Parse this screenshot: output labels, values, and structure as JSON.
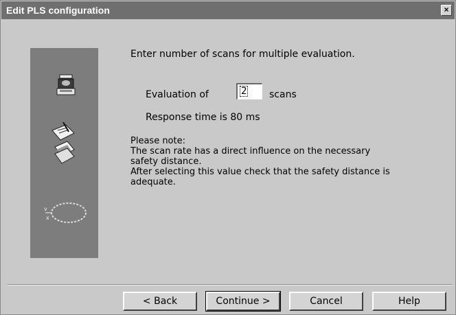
{
  "window": {
    "title": "Edit PLS configuration",
    "close_glyph": "×"
  },
  "content": {
    "instruction": "Enter number of scans for multiple evaluation.",
    "evaluation_label": "Evaluation of",
    "evaluation_value": "2",
    "scans_label": "scans",
    "response_time": "Response time is 80 ms",
    "note_lines": [
      "Please note:",
      "The scan rate has a direct influence on the necessary",
      "safety distance.",
      "After selecting this value check that the safety distance is",
      "adequate."
    ]
  },
  "side_panel": {
    "icons": [
      "scanner-device-icon",
      "documents-icon",
      "protective-field-icon"
    ]
  },
  "buttons": {
    "back": "< Back",
    "continue": "Continue >",
    "cancel": "Cancel",
    "help": "Help"
  }
}
